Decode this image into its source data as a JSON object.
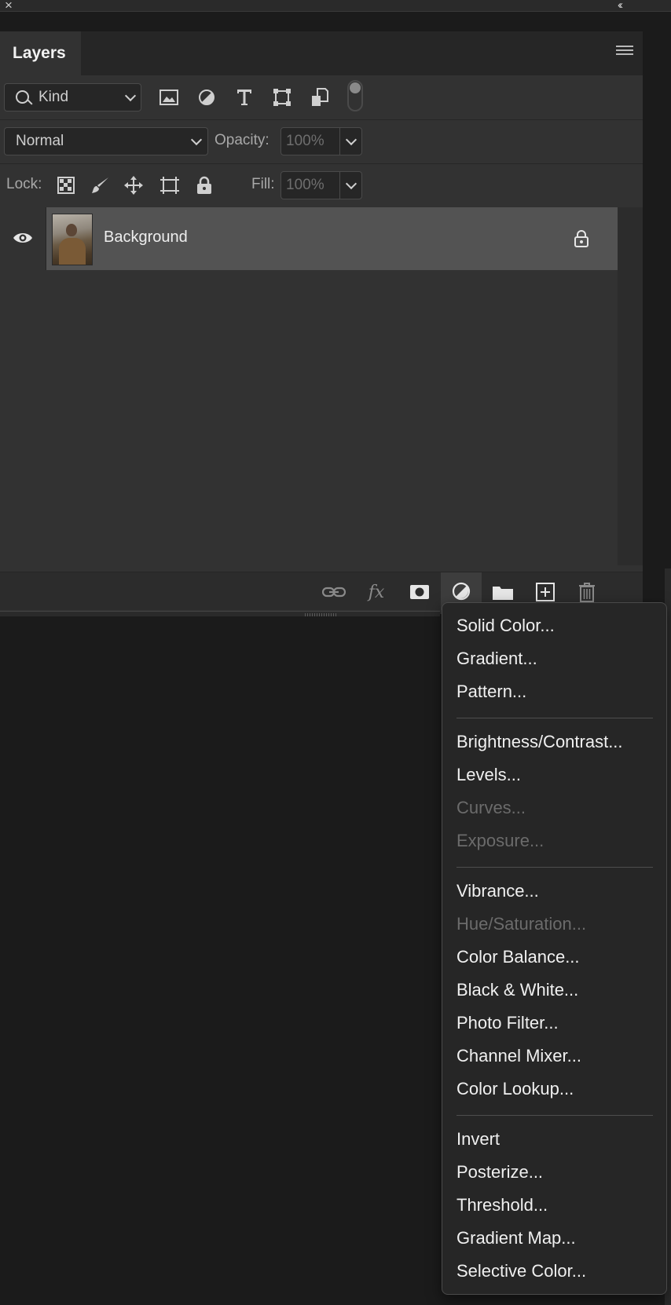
{
  "panel": {
    "tab_label": "Layers",
    "kind_filter": "Kind",
    "filter_icons": [
      "pixel-layer-filter-icon",
      "adjustment-layer-filter-icon",
      "type-layer-filter-icon",
      "shape-layer-filter-icon",
      "smart-object-filter-icon"
    ],
    "blend_mode": "Normal",
    "opacity_label": "Opacity:",
    "opacity_value": "100%",
    "lock_label": "Lock:",
    "fill_label": "Fill:",
    "fill_value": "100%"
  },
  "layers": [
    {
      "name": "Background",
      "visible": true,
      "locked": true
    }
  ],
  "bottom_toolbar": [
    "link-layers-icon",
    "fx-icon",
    "add-mask-icon",
    "adjustment-layer-icon",
    "new-group-icon",
    "new-layer-icon",
    "delete-layer-icon"
  ],
  "adjustment_menu": {
    "items": [
      {
        "label": "Solid Color...",
        "enabled": true
      },
      {
        "label": "Gradient...",
        "enabled": true
      },
      {
        "label": "Pattern...",
        "enabled": true
      },
      {
        "label": "Brightness/Contrast...",
        "enabled": true
      },
      {
        "label": "Levels...",
        "enabled": true
      },
      {
        "label": "Curves...",
        "enabled": false
      },
      {
        "label": "Exposure...",
        "enabled": false
      },
      {
        "label": "Vibrance...",
        "enabled": true
      },
      {
        "label": "Hue/Saturation...",
        "enabled": false
      },
      {
        "label": "Color Balance...",
        "enabled": true
      },
      {
        "label": "Black & White...",
        "enabled": true
      },
      {
        "label": "Photo Filter...",
        "enabled": true
      },
      {
        "label": "Channel Mixer...",
        "enabled": true
      },
      {
        "label": "Color Lookup...",
        "enabled": true
      },
      {
        "label": "Invert",
        "enabled": true
      },
      {
        "label": "Posterize...",
        "enabled": true
      },
      {
        "label": "Threshold...",
        "enabled": true
      },
      {
        "label": "Gradient Map...",
        "enabled": true
      },
      {
        "label": "Selective Color...",
        "enabled": true
      }
    ]
  },
  "colors": {
    "panel_bg": "#323232",
    "selected_layer_bg": "#535353",
    "menu_bg": "#262626",
    "disabled_text": "#6b6b6b"
  }
}
